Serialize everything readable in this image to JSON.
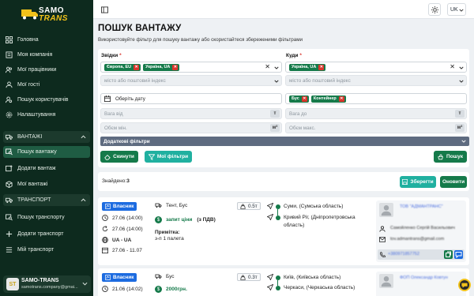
{
  "brand": {
    "name_part1": "SAMO",
    "name_part2": "TRANS"
  },
  "sidebar": {
    "items": [
      {
        "label": "Головна",
        "icon": "grid-icon"
      },
      {
        "label": "Моя компанія",
        "icon": "building-icon"
      },
      {
        "label": "Мої працівники",
        "icon": "users-icon"
      },
      {
        "label": "Мої гості",
        "icon": "guests-icon"
      },
      {
        "label": "Пошук користувачів",
        "icon": "user-search-icon"
      },
      {
        "label": "Налаштування",
        "icon": "gear-icon"
      }
    ],
    "cargo_section": {
      "label": "ВАНТАЖІ",
      "items": [
        {
          "label": "Пошук вантажу",
          "active": true
        },
        {
          "label": "Додати вантаж"
        },
        {
          "label": "Мої вантажі"
        }
      ]
    },
    "transport_section": {
      "label": "ТРАНСПОРТ",
      "items": [
        {
          "label": "Пошук транспорту"
        },
        {
          "label": "Додати транспорт"
        },
        {
          "label": "Мій транспорт"
        }
      ]
    },
    "user": {
      "initials": "ST",
      "name": "SAMO-TRANS",
      "email": "samotrans.company@gmai..."
    }
  },
  "topbar": {
    "language": "UK"
  },
  "page": {
    "title": "ПОШУК ВАНТАЖУ",
    "subtitle": "Використовуйте фільтр для пошуку вантажу або скористайтеся збереженими фільтрами"
  },
  "filters": {
    "from": {
      "label": "Звідки",
      "required": "*",
      "tags": [
        "Європа, EU",
        "Україна, UA"
      ],
      "placeholder": "місто або поштовий індекс"
    },
    "to": {
      "label": "Куди",
      "required": "*",
      "tags": [
        "Україна, UA"
      ],
      "placeholder": "місто або поштовий індекс"
    },
    "date_placeholder": "Оберіть дату",
    "vehicle_tags": [
      "Бус",
      "Контейнер"
    ],
    "weight_from": "Вага від",
    "weight_to": "Вага до",
    "weight_unit": "т",
    "volume_min": "Обєм мін.",
    "volume_max": "Обєм макс.",
    "volume_unit": "м³",
    "extra_label": "Додаткові фільтри",
    "reset_button": "Скинути",
    "my_filters_button": "Мої фільтри",
    "search_button": "Пошук"
  },
  "results": {
    "found_label": "Знайдено:",
    "found_count": "3",
    "save_button": "Зберегти",
    "refresh_button": "Оновити"
  },
  "loads": [
    {
      "owner_label": "Власник",
      "created": "27.06 (14:00)",
      "updated": "27.06 (14:00)",
      "countries": "UA - UA",
      "dates": "27.06 - 11.07",
      "vehicle": "Тент, Бус",
      "weight": "0.5т",
      "price": "запит ціни",
      "vat": "(з ПДВ)",
      "note_title": "Примітка:",
      "note": "з-п 1 палета",
      "from_city": "Суми, (Сумська область)",
      "to_city": "Кривий Ріг, (Дніпропетровська область)",
      "company": "ТОВ \"АДМАНТРАНС\"",
      "person": "Самойленко Сергій Васильович",
      "email": "tov.admantrans@gmail.com",
      "phone": "+380971857752"
    },
    {
      "owner_label": "Власник",
      "created": "21.06 (14:02)",
      "vehicle": "Бус",
      "weight": "0.3т",
      "price": "2000грн.",
      "from_city": "Київ, (Київська область)",
      "to_city": "Черкаси, (Черкаська область)",
      "company": "ФОП Олександр Ковтун"
    }
  ],
  "colors": {
    "sidebar": "#0d2a1e",
    "accent": "#157a4a",
    "blue": "#1c6be0",
    "danger": "#d9352c",
    "filter_bar": "#5e6b80"
  }
}
